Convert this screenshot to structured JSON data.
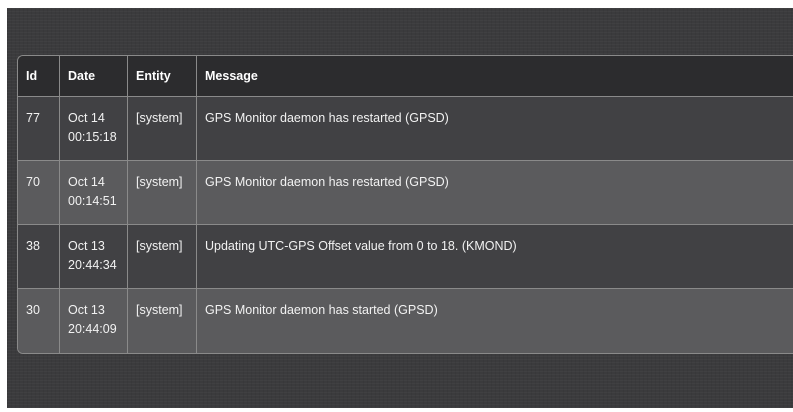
{
  "table": {
    "headers": {
      "id": "Id",
      "date": "Date",
      "entity": "Entity",
      "message": "Message"
    },
    "rows": [
      {
        "id": "77",
        "date_day": "Oct 14",
        "date_time": "00:15:18",
        "entity": "[system]",
        "message": "GPS Monitor daemon has restarted (GPSD)"
      },
      {
        "id": "70",
        "date_day": "Oct 14",
        "date_time": "00:14:51",
        "entity": "[system]",
        "message": "GPS Monitor daemon has restarted (GPSD)"
      },
      {
        "id": "38",
        "date_day": "Oct 13",
        "date_time": "20:44:34",
        "entity": "[system]",
        "message": "Updating UTC-GPS Offset value from 0 to 18. (KMOND)"
      },
      {
        "id": "30",
        "date_day": "Oct 13",
        "date_time": "20:44:09",
        "entity": "[system]",
        "message": "GPS Monitor daemon has started (GPSD)"
      }
    ]
  },
  "colors": {
    "background": "#3b3b3d",
    "header_row": "#2c2c2e",
    "row_odd": "#414144",
    "row_even": "#5b5b5d",
    "border": "#8a8a8a",
    "text": "#f2f2f2"
  }
}
